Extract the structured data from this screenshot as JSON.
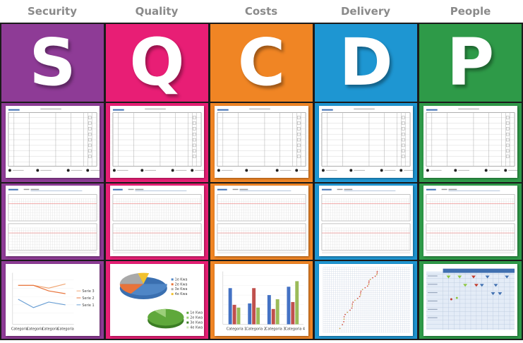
{
  "columns": [
    {
      "header": "Security",
      "letter": "S",
      "color": "#8e3b96"
    },
    {
      "header": "Quality",
      "letter": "Q",
      "color": "#e81e75"
    },
    {
      "header": "Costs",
      "letter": "C",
      "color": "#f08524"
    },
    {
      "header": "Delivery",
      "letter": "D",
      "color": "#1e96d2"
    },
    {
      "header": "People",
      "letter": "P",
      "color": "#2e9a48"
    }
  ],
  "security_chart": {
    "series": [
      {
        "name": "Serie 3",
        "color": "#f0a674"
      },
      {
        "name": "Serie 2",
        "color": "#e8733a"
      },
      {
        "name": "Serie 1",
        "color": "#6a9fd4"
      }
    ],
    "categories": [
      "Categoria",
      "Categoria",
      "Categoria",
      "Categoria"
    ]
  },
  "quality_chart": {
    "legend_a": [
      "1e Kwa",
      "2e Kwa",
      "3e Kwa",
      "4e Kwa"
    ],
    "legend_b": [
      "1e Kwa",
      "2e Kwa",
      "3e Kwa",
      "4e Kwa"
    ]
  },
  "costs_chart": {
    "categories": [
      "Categoria 1",
      "Categoria 2",
      "Categoria 3",
      "Categoria 4"
    ],
    "colors": [
      "#4472c4",
      "#c0504d",
      "#9bbb59"
    ]
  }
}
